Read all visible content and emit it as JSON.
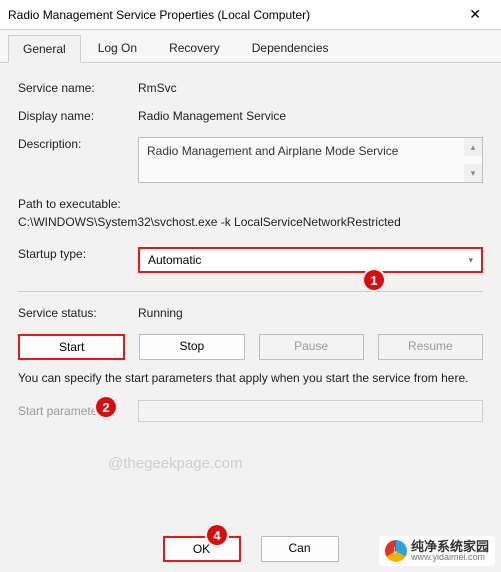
{
  "window": {
    "title": "Radio Management Service Properties (Local Computer)"
  },
  "tabs": {
    "general": "General",
    "logon": "Log On",
    "recovery": "Recovery",
    "dependencies": "Dependencies"
  },
  "labels": {
    "service_name": "Service name:",
    "display_name": "Display name:",
    "description": "Description:",
    "path_label": "Path to executable:",
    "startup_type": "Startup type:",
    "service_status": "Service status:",
    "start_params_help": "You can specify the start parameters that apply when you start the service from here.",
    "start_parameters": "Start parameters:"
  },
  "values": {
    "service_name": "RmSvc",
    "display_name": "Radio Management Service",
    "description": "Radio Management and Airplane Mode Service",
    "path": "C:\\WINDOWS\\System32\\svchost.exe -k LocalServiceNetworkRestricted",
    "startup_type": "Automatic",
    "service_status": "Running"
  },
  "buttons": {
    "start": "Start",
    "stop": "Stop",
    "pause": "Pause",
    "resume": "Resume",
    "ok": "OK",
    "cancel": "Can"
  },
  "callouts": {
    "c1": "1",
    "c2": "2",
    "c4": "4"
  },
  "watermark": {
    "center": "@thegeekpage.com",
    "brand_cn": "纯净系统家园",
    "brand_url": "www.yidaimei.com"
  }
}
